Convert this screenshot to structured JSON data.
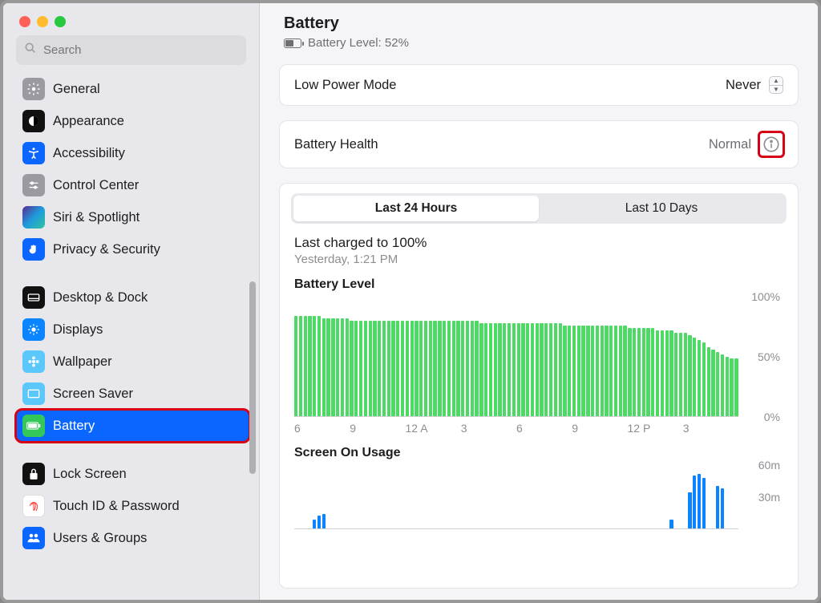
{
  "search": {
    "placeholder": "Search"
  },
  "sidebar": {
    "items": [
      {
        "label": "General"
      },
      {
        "label": "Appearance"
      },
      {
        "label": "Accessibility"
      },
      {
        "label": "Control Center"
      },
      {
        "label": "Siri & Spotlight"
      },
      {
        "label": "Privacy & Security"
      },
      {
        "label": "Desktop & Dock"
      },
      {
        "label": "Displays"
      },
      {
        "label": "Wallpaper"
      },
      {
        "label": "Screen Saver"
      },
      {
        "label": "Battery"
      },
      {
        "label": "Lock Screen"
      },
      {
        "label": "Touch ID & Password"
      },
      {
        "label": "Users & Groups"
      }
    ]
  },
  "header": {
    "title": "Battery",
    "sub": "Battery Level: 52%"
  },
  "lowpower": {
    "label": "Low Power Mode",
    "value": "Never"
  },
  "health": {
    "label": "Battery Health",
    "value": "Normal"
  },
  "tabs": {
    "a": "Last 24 Hours",
    "b": "Last 10 Days"
  },
  "charged": {
    "title": "Last charged to 100%",
    "when": "Yesterday, 1:21 PM"
  },
  "charts": {
    "level": {
      "title": "Battery Level",
      "y100": "100%",
      "y50": "50%",
      "y0": "0%"
    },
    "usage": {
      "title": "Screen On Usage",
      "y60": "60m",
      "y30": "30m"
    },
    "xticks": [
      "6",
      "9",
      "12 A",
      "3",
      "6",
      "9",
      "12 P",
      "3"
    ]
  },
  "chart_data": [
    {
      "type": "bar",
      "title": "Battery Level",
      "ylabel": "%",
      "ylim": [
        0,
        100
      ],
      "xticks": [
        "6",
        "9",
        "12 A",
        "3",
        "6",
        "9",
        "12 P",
        "3"
      ],
      "values": [
        84,
        84,
        84,
        84,
        84,
        84,
        82,
        82,
        82,
        82,
        82,
        82,
        80,
        80,
        80,
        80,
        80,
        80,
        80,
        80,
        80,
        80,
        80,
        80,
        80,
        80,
        80,
        80,
        80,
        80,
        80,
        80,
        80,
        80,
        80,
        80,
        80,
        80,
        80,
        80,
        78,
        78,
        78,
        78,
        78,
        78,
        78,
        78,
        78,
        78,
        78,
        78,
        78,
        78,
        78,
        78,
        78,
        78,
        76,
        76,
        76,
        76,
        76,
        76,
        76,
        76,
        76,
        76,
        76,
        76,
        76,
        76,
        74,
        74,
        74,
        74,
        74,
        74,
        72,
        72,
        72,
        72,
        70,
        70,
        70,
        68,
        66,
        64,
        62,
        58,
        56,
        54,
        52,
        50,
        48,
        48
      ]
    },
    {
      "type": "bar",
      "title": "Screen On Usage",
      "ylabel": "minutes",
      "ylim": [
        0,
        60
      ],
      "xticks": [
        "6",
        "9",
        "12 A",
        "3",
        "6",
        "9",
        "12 P",
        "3"
      ],
      "values": [
        0,
        0,
        0,
        0,
        8,
        12,
        14,
        0,
        0,
        0,
        0,
        0,
        0,
        0,
        0,
        0,
        0,
        0,
        0,
        0,
        0,
        0,
        0,
        0,
        0,
        0,
        0,
        0,
        0,
        0,
        0,
        0,
        0,
        0,
        0,
        0,
        0,
        0,
        0,
        0,
        0,
        0,
        0,
        0,
        0,
        0,
        0,
        0,
        0,
        0,
        0,
        0,
        0,
        0,
        0,
        0,
        0,
        0,
        0,
        0,
        0,
        0,
        0,
        0,
        0,
        0,
        0,
        0,
        0,
        0,
        0,
        0,
        0,
        0,
        0,
        0,
        0,
        0,
        0,
        0,
        0,
        8,
        0,
        0,
        0,
        34,
        50,
        52,
        48,
        0,
        0,
        40,
        38,
        0,
        0,
        0
      ]
    }
  ]
}
